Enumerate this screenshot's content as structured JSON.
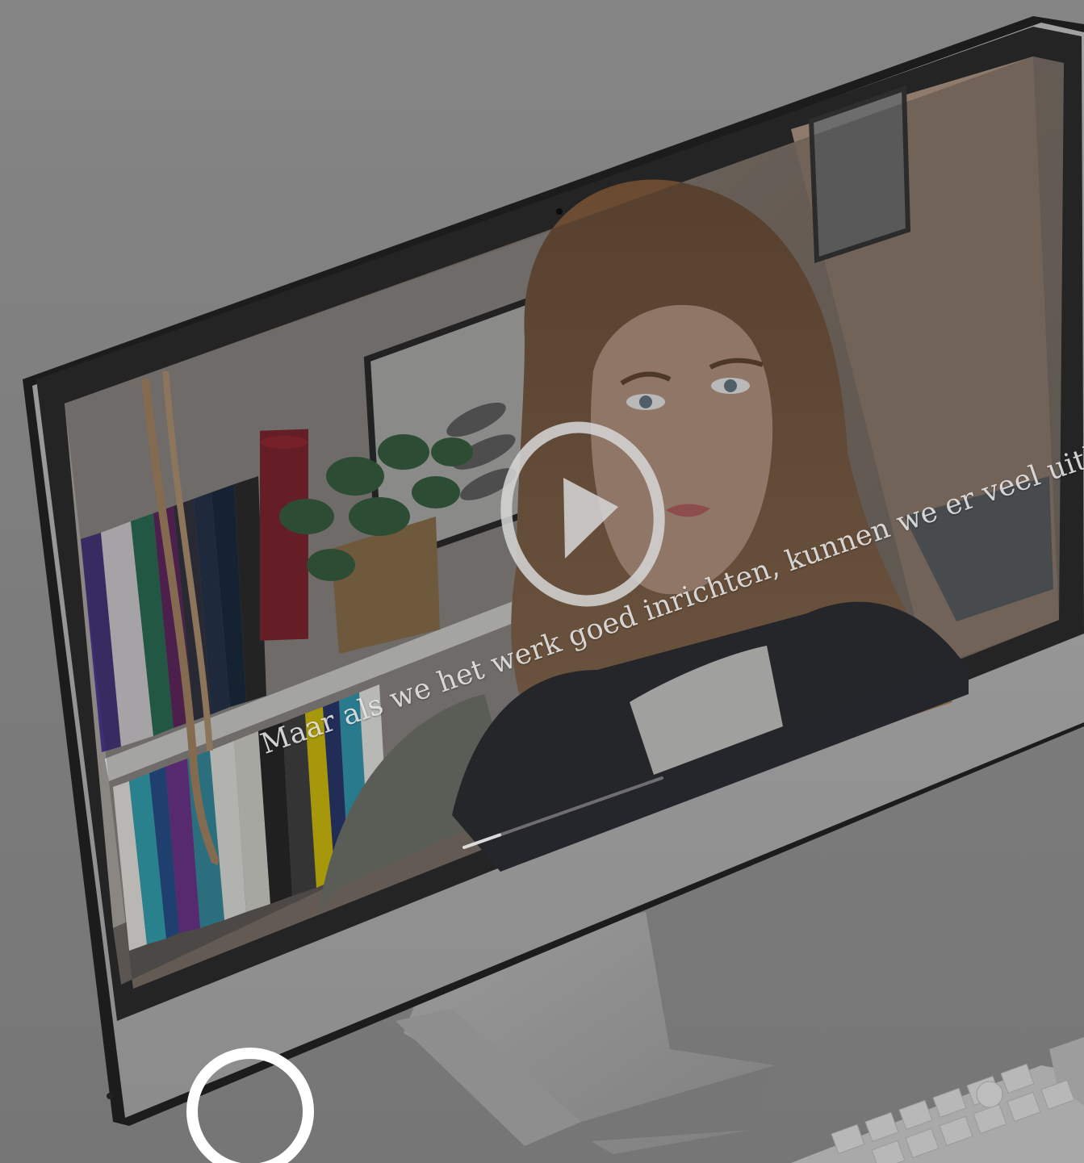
{
  "video": {
    "subtitle": "Maar als we het werk goed inrichten, kunnen we er veel uithalen.",
    "progress": 0.18
  },
  "icons": {
    "play": "play-icon",
    "ring": "circle-ring-icon",
    "camera": "webcam-icon"
  },
  "colors": {
    "overlay": "#7d7d7d",
    "bezel": "#1e1e1e",
    "chin": "#9a9a9a",
    "play_ring": "#d8d8d8",
    "ring": "#ffffff"
  }
}
